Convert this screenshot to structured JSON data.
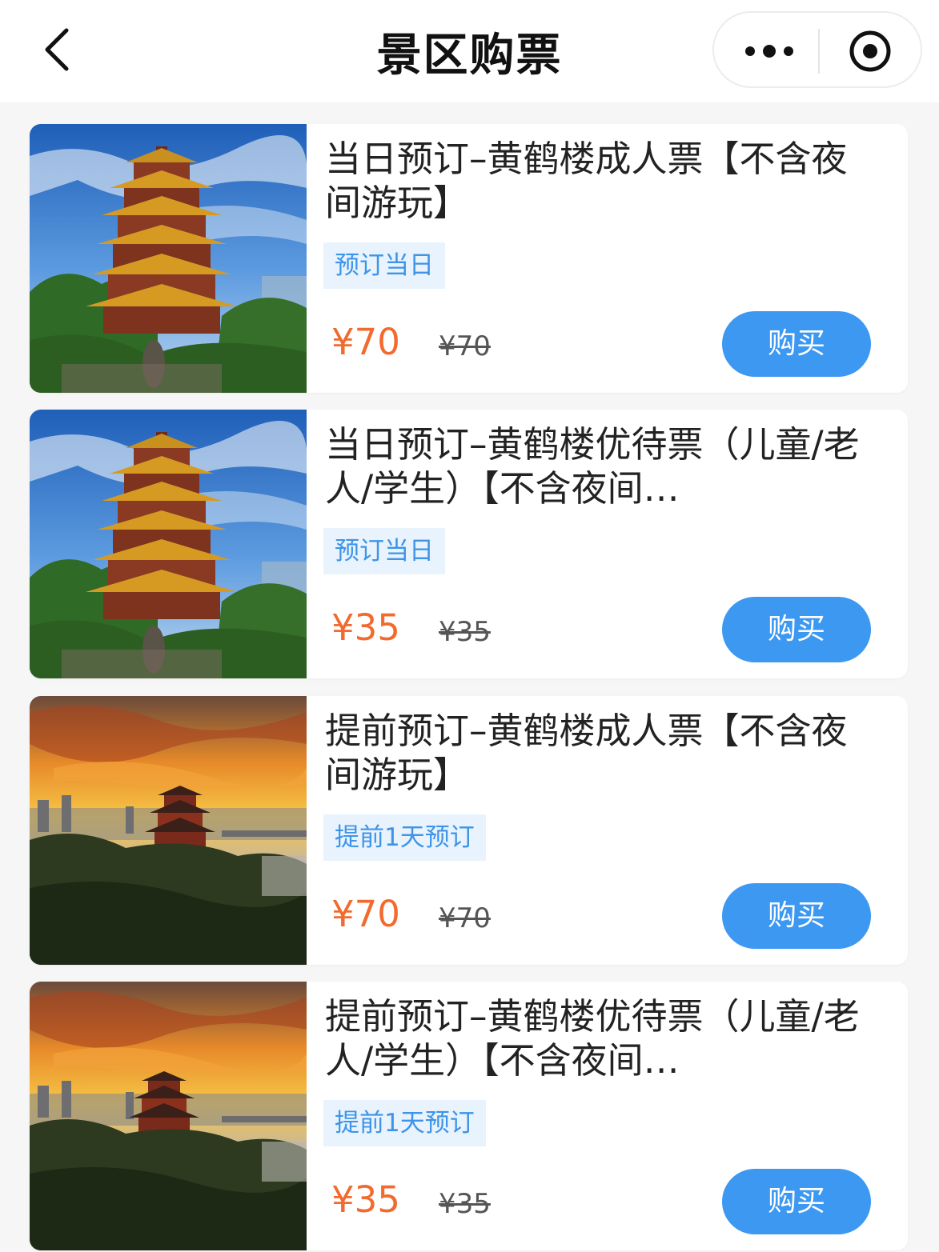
{
  "header": {
    "title": "景区购票",
    "back_icon": "chevron-left-icon",
    "more_icon": "more-dots-icon",
    "close_icon": "target-close-icon"
  },
  "colors": {
    "price": "#f26a2e",
    "buy_button": "#3d98f2",
    "tag_text": "#3d94e8",
    "tag_bg": "#e9f3fd"
  },
  "tickets": [
    {
      "name": "当日预订–黄鹤楼成人票【不含夜间游玩】",
      "tag": "预订当日",
      "price": "¥70",
      "original_price": "¥70",
      "buy_label": "购买",
      "image": "yellow-crane-tower-daytime"
    },
    {
      "name": "当日预订–黄鹤楼优待票（儿童/老人/学生）【不含夜间…",
      "tag": "预订当日",
      "price": "¥35",
      "original_price": "¥35",
      "buy_label": "购买",
      "image": "yellow-crane-tower-daytime"
    },
    {
      "name": "提前预订–黄鹤楼成人票【不含夜间游玩】",
      "tag": "提前1天预订",
      "price": "¥70",
      "original_price": "¥70",
      "buy_label": "购买",
      "image": "yellow-crane-tower-sunset"
    },
    {
      "name": "提前预订–黄鹤楼优待票（儿童/老人/学生）【不含夜间…",
      "tag": "提前1天预订",
      "price": "¥35",
      "original_price": "¥35",
      "buy_label": "购买",
      "image": "yellow-crane-tower-sunset"
    }
  ]
}
